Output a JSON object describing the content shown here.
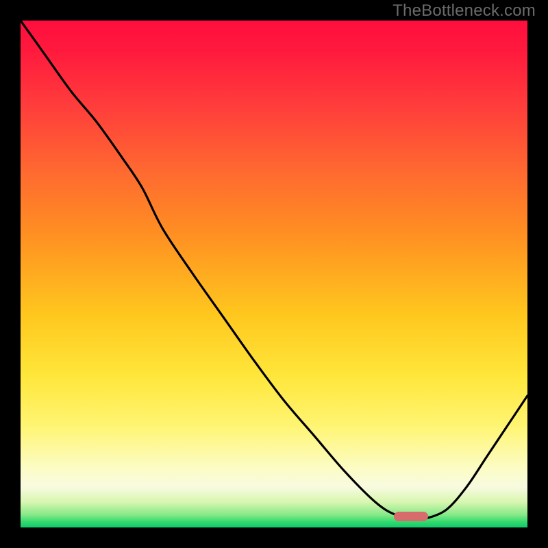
{
  "watermark": "TheBottleneck.com",
  "colors": {
    "background": "#000000",
    "curve_stroke": "#000000",
    "indicator": "#d86b6b",
    "gradient_top": "#ff0e3d",
    "gradient_bottom": "#12c86e"
  },
  "chart_data": {
    "type": "line",
    "title": "",
    "xlabel": "",
    "ylabel": "",
    "xlim": [
      0,
      100
    ],
    "ylim": [
      0,
      100
    ],
    "grid": false,
    "series": [
      {
        "name": "bottleneck-curve",
        "x": [
          0,
          5,
          10,
          15,
          20,
          24,
          28,
          34,
          40,
          46,
          52,
          58,
          64,
          70,
          74,
          78,
          80,
          84,
          88,
          92,
          96,
          100
        ],
        "y": [
          100,
          93,
          86,
          80,
          73,
          67,
          59,
          50,
          41.5,
          33,
          25,
          18,
          11,
          5,
          2.5,
          1.8,
          1.8,
          3.5,
          8,
          14,
          20,
          26
        ]
      }
    ],
    "indicator": {
      "x": 77,
      "y": 2.2
    },
    "annotations": []
  }
}
